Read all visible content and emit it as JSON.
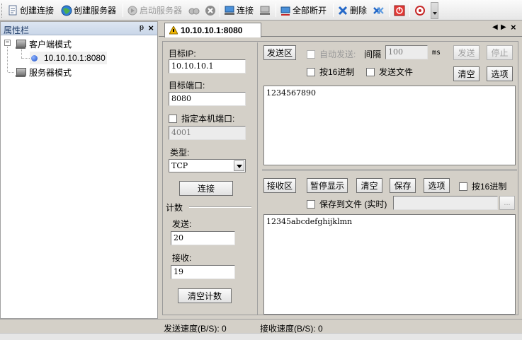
{
  "toolbar": {
    "create_connection": "创建连接",
    "create_server": "创建服务器",
    "start_server": "启动服务器",
    "connect": "连接",
    "disconnect_all": "全部断开",
    "delete": "删除"
  },
  "left_panel": {
    "title": "属性栏",
    "pin": "ᵽ",
    "close": "×",
    "tree": {
      "client_mode": "客户端模式",
      "client_item": "10.10.10.1:8080",
      "server_mode": "服务器模式"
    }
  },
  "tab": {
    "label": "10.10.10.1:8080",
    "nav_left": "◀",
    "nav_right": "▶",
    "close": "×"
  },
  "config": {
    "target_ip_label": "目标IP:",
    "target_ip_value": "10.10.10.1",
    "target_port_label": "目标端口:",
    "target_port_value": "8080",
    "local_port_label": "指定本机端口:",
    "local_port_value": "4001",
    "type_label": "类型:",
    "type_value": "TCP",
    "connect_button": "连接",
    "count_label": "计数",
    "send_label": "发送:",
    "send_count": "20",
    "recv_label": "接收:",
    "recv_count": "19",
    "clear_count_button": "清空计数"
  },
  "send": {
    "area_button": "发送区",
    "auto_send_label": "自动发送:",
    "interval_label": "间隔",
    "interval_value": "100",
    "interval_unit": "ms",
    "send_button": "发送",
    "stop_button": "停止",
    "hex_label": "按16进制",
    "send_file_label": "发送文件",
    "clear_button": "清空",
    "options_button": "选项",
    "content": "1234567890"
  },
  "receive": {
    "area_button": "接收区",
    "pause_button": "暂停显示",
    "clear_button": "清空",
    "save_button": "保存",
    "options_button": "选项",
    "hex_label": "按16进制",
    "save_file_label": "保存到文件 (实时)",
    "browse_button": "...",
    "content": "12345abcdefghijklmn"
  },
  "status": {
    "send_speed": "发送速度(B/S): 0",
    "recv_speed": "接收速度(B/S): 0"
  }
}
